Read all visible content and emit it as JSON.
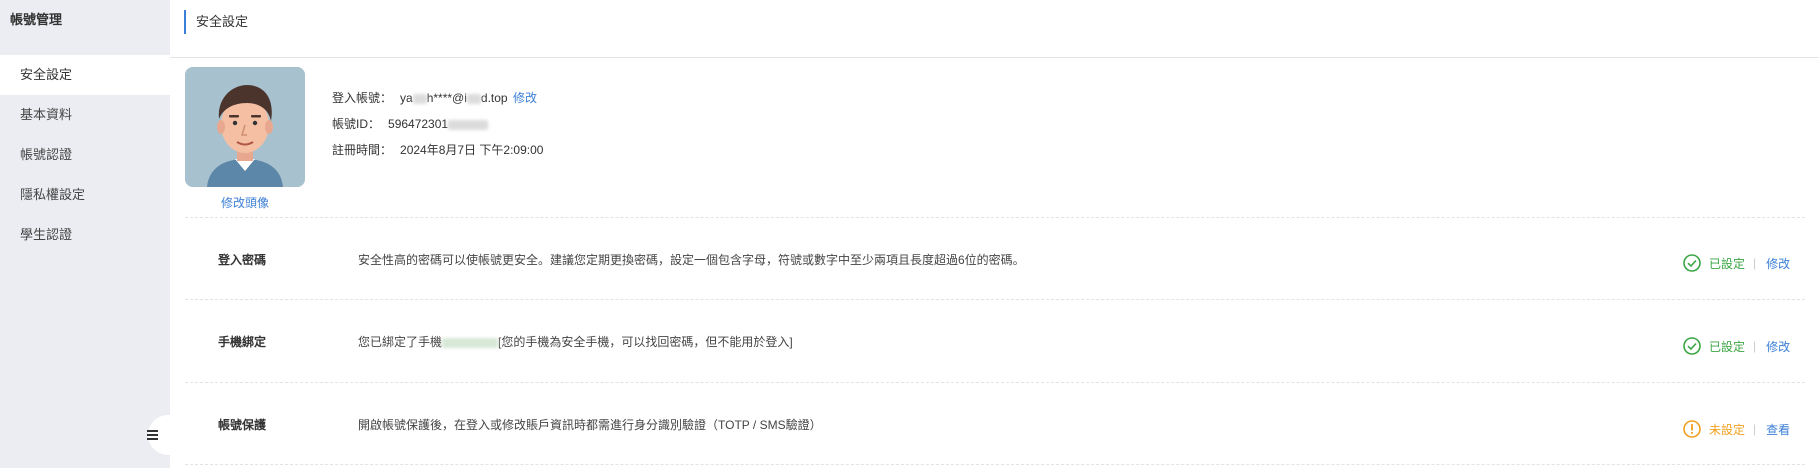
{
  "sidebar": {
    "title": "帳號管理",
    "items": [
      {
        "label": "安全設定"
      },
      {
        "label": "基本資料"
      },
      {
        "label": "帳號認證"
      },
      {
        "label": "隱私權設定"
      },
      {
        "label": "學生認證"
      }
    ]
  },
  "header": {
    "title": "安全設定"
  },
  "profile": {
    "change_avatar_label": "修改頭像",
    "account_label": "登入帳號：",
    "account_prefix": "ya",
    "account_mid": "h****@i",
    "account_suffix": "d.top",
    "account_edit_label": "修改",
    "id_label": "帳號ID：",
    "id_value": "596472301",
    "registered_label": "註冊時間：",
    "registered_value": "2024年8月7日 下午2:09:00"
  },
  "settings": [
    {
      "name": "登入密碼",
      "description": "安全性高的密碼可以使帳號更安全。建議您定期更換密碼，設定一個包含字母，符號或數字中至少兩項且長度超過6位的密碼。",
      "status": "已設定",
      "status_type": "ok",
      "action": "修改"
    },
    {
      "name": "手機綁定",
      "description_prefix": "您已綁定了手機",
      "description_suffix": "[您的手機為安全手機，可以找回密碼，但不能用於登入]",
      "status": "已設定",
      "status_type": "ok",
      "action": "修改"
    },
    {
      "name": "帳號保護",
      "description": "開啟帳號保護後，在登入或修改賬戶資訊時都需進行身分識別驗證（TOTP / SMS驗證）",
      "status": "未設定",
      "status_type": "warn",
      "action": "查看"
    }
  ],
  "colors": {
    "accent": "#3b7fd6",
    "ok": "#3aa544",
    "warn": "#f0a020",
    "sidebar_bg": "#ebedf2"
  }
}
